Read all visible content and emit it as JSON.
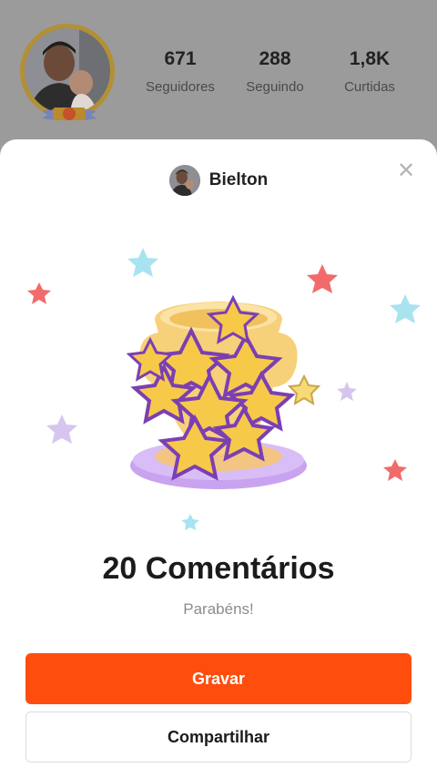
{
  "profile": {
    "stats": [
      {
        "value": "671",
        "label": "Seguidores"
      },
      {
        "value": "288",
        "label": "Seguindo"
      },
      {
        "value": "1,8K",
        "label": "Curtidas"
      }
    ]
  },
  "sheet": {
    "username": "Bielton",
    "close_icon": "close-icon",
    "achievement_title": "20 Comentários",
    "achievement_subtitle": "Parabéns!",
    "primary_button": "Gravar",
    "secondary_button": "Compartilhar"
  },
  "colors": {
    "accent": "#ff4d0d",
    "trophy_gold": "#f7c948",
    "pedestal": "#c9a3f0"
  }
}
